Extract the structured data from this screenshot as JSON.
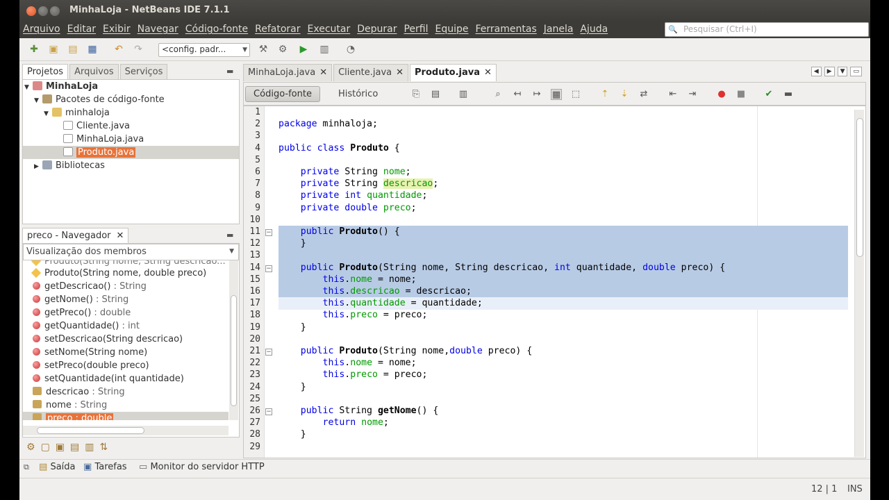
{
  "window": {
    "title": "MinhaLoja - NetBeans IDE 7.1.1"
  },
  "menu": [
    "Arquivo",
    "Editar",
    "Exibir",
    "Navegar",
    "Código-fonte",
    "Refatorar",
    "Executar",
    "Depurar",
    "Perfil",
    "Equipe",
    "Ferramentas",
    "Janela",
    "Ajuda"
  ],
  "search": {
    "placeholder": "Pesquisar (Ctrl+I)"
  },
  "toolbar": {
    "config_value": "<config. padr..."
  },
  "projects_panel": {
    "tabs": [
      "Projetos",
      "Arquivos",
      "Serviços"
    ],
    "tree": {
      "project": "MinhaLoja",
      "source_packages": "Pacotes de código-fonte",
      "package": "minhaloja",
      "files": [
        "Cliente.java",
        "MinhaLoja.java",
        "Produto.java"
      ],
      "selected_file": "Produto.java",
      "libraries": "Bibliotecas"
    }
  },
  "navigator": {
    "title": "preco - Navegador",
    "view": "Visualização dos membros",
    "members": [
      {
        "kind": "constructor",
        "name": "Produto",
        "sig": "(String nome, String descricao...",
        "type": ""
      },
      {
        "kind": "constructor",
        "name": "Produto",
        "sig": "(String nome, double preco)",
        "type": ""
      },
      {
        "kind": "method",
        "name": "getDescricao()",
        "sig": "",
        "type": " : String"
      },
      {
        "kind": "method",
        "name": "getNome()",
        "sig": "",
        "type": " : String"
      },
      {
        "kind": "method",
        "name": "getPreco()",
        "sig": "",
        "type": " : double"
      },
      {
        "kind": "method",
        "name": "getQuantidade()",
        "sig": "",
        "type": " : int"
      },
      {
        "kind": "method",
        "name": "setDescricao(String descricao)",
        "sig": "",
        "type": ""
      },
      {
        "kind": "method",
        "name": "setNome(String nome)",
        "sig": "",
        "type": ""
      },
      {
        "kind": "method",
        "name": "setPreco(double preco)",
        "sig": "",
        "type": ""
      },
      {
        "kind": "method",
        "name": "setQuantidade(int quantidade)",
        "sig": "",
        "type": ""
      },
      {
        "kind": "field",
        "name": "descricao",
        "sig": "",
        "type": " : String"
      },
      {
        "kind": "field",
        "name": "nome",
        "sig": "",
        "type": " : String"
      },
      {
        "kind": "field",
        "name": "preco",
        "sig": "",
        "type": " : double"
      }
    ],
    "selected_member": "preco : double"
  },
  "editor": {
    "tabs": [
      "MinhaLoja.java",
      "Cliente.java",
      "Produto.java"
    ],
    "active_tab": "Produto.java",
    "source_button": "Código-fonte",
    "history_button": "Histórico",
    "line_numbers": [
      "1",
      "2",
      "3",
      "4",
      "5",
      "6",
      "7",
      "8",
      "9",
      "10",
      "11",
      "12",
      "13",
      "14",
      "15",
      "16",
      "17",
      "18",
      "19",
      "20",
      "21",
      "22",
      "23",
      "24",
      "25",
      "26",
      "27",
      "28",
      "29"
    ],
    "code": [
      "",
      "package minhaloja;",
      "",
      "public class Produto {",
      "",
      "    private String nome;",
      "    private String descricao;",
      "    private int quantidade;",
      "    private double preco;",
      "",
      "    public Produto() {",
      "    }",
      "",
      "    public Produto(String nome, String descricao, int quantidade, double preco) {",
      "        this.nome = nome;",
      "        this.descricao = descricao;",
      "        this.quantidade = quantidade;",
      "        this.preco = preco;",
      "    }",
      "",
      "    public Produto(String nome,double preco) {",
      "        this.nome = nome;",
      "        this.preco = preco;",
      "    }",
      "",
      "    public String getNome() {",
      "        return nome;",
      "    }",
      ""
    ]
  },
  "bottom": {
    "tabs": [
      "Saída",
      "Tarefas",
      "Monitor do servidor HTTP"
    ]
  },
  "status": {
    "position": "12 | 1",
    "mode": "INS"
  }
}
